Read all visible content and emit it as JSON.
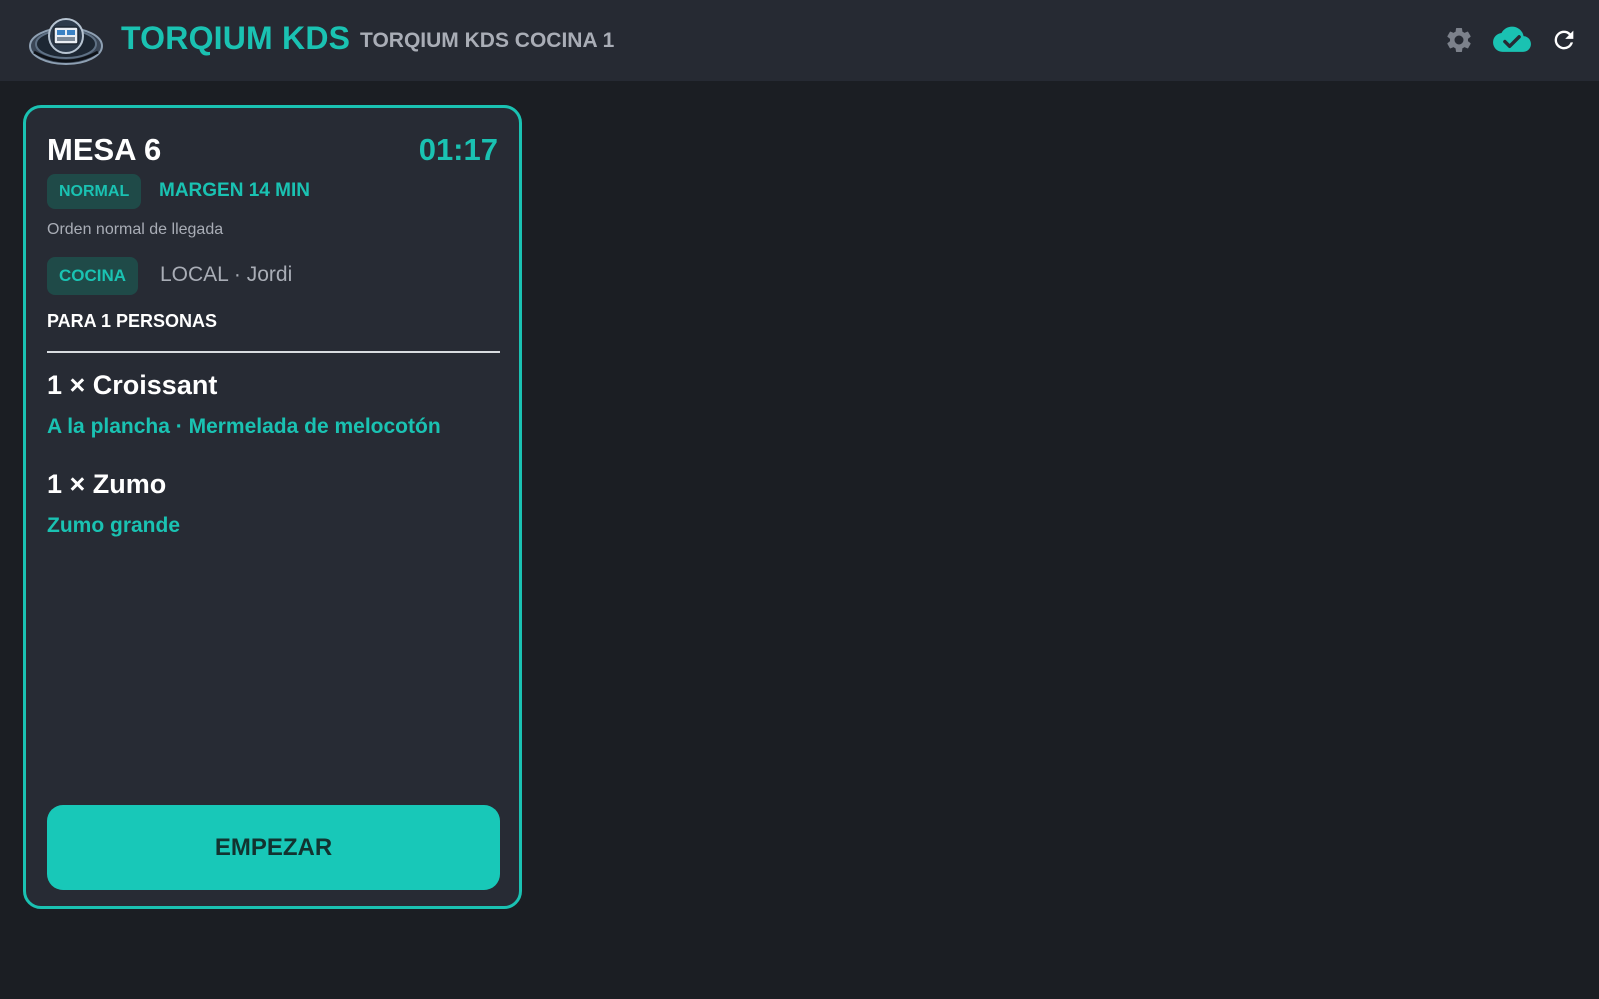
{
  "header": {
    "brand": "TORQIUM KDS",
    "station_name": "TORQIUM KDS COCINA 1",
    "icons": [
      "gear-icon",
      "cloud-check-icon",
      "refresh-icon"
    ]
  },
  "colors": {
    "accent": "#1ac2b2",
    "background": "#1b1e23",
    "header_bg": "#262a33",
    "card_bg": "#272b34",
    "badge_bg": "#1f4a48",
    "muted_text": "#a9adb6"
  },
  "order": {
    "table": "MESA 6",
    "timer": "01:17",
    "priority": "NORMAL",
    "margin": "MARGEN 14 MIN",
    "note": "Orden normal de llegada",
    "station": "COCINA",
    "service": "LOCAL · Jordi",
    "guests": "PARA 1 PERSONAS",
    "items": [
      {
        "title": "1 × Croissant",
        "modifiers": "A la plancha · Mermelada de melocotón"
      },
      {
        "title": "1 × Zumo",
        "modifiers": "Zumo grande"
      }
    ],
    "action_label": "EMPEZAR"
  }
}
